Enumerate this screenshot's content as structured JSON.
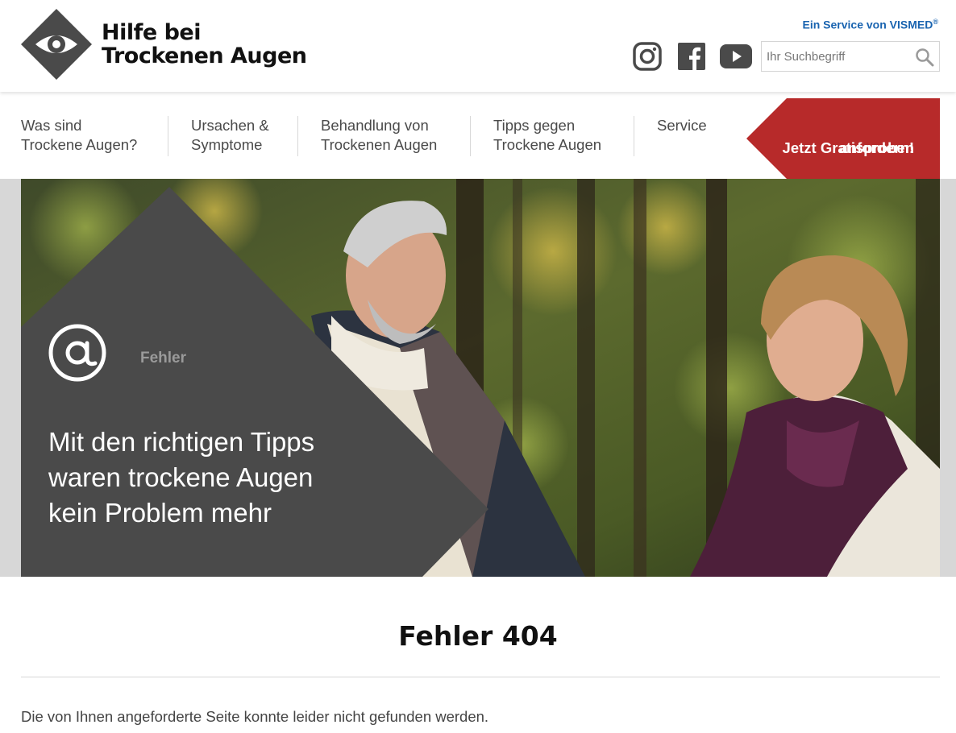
{
  "header": {
    "logo_line1": "Hilfe bei",
    "logo_line2": "Trockenen Augen",
    "service_text": "Ein Service von VISMED",
    "service_mark": "®",
    "social": [
      {
        "name": "instagram-icon"
      },
      {
        "name": "facebook-icon"
      },
      {
        "name": "youtube-icon"
      }
    ],
    "search": {
      "placeholder": "Ihr Suchbegriff",
      "value": ""
    }
  },
  "nav": {
    "items": [
      {
        "line1": "Was sind",
        "line2": "Trockene Augen?"
      },
      {
        "line1": "Ursachen &",
        "line2": "Symptome"
      },
      {
        "line1": "Behandlung von",
        "line2": "Trockenen Augen"
      },
      {
        "line1": "Tipps gegen",
        "line2": "Trockene Augen"
      },
      {
        "line1": "Service",
        "line2": ""
      }
    ],
    "cta_line1": "Jetzt Gratisproben",
    "cta_line2": "anfordern!"
  },
  "hero": {
    "icon": "at-icon",
    "label": "Fehler",
    "text_line1": "Mit den richtigen Tipps",
    "text_line2": "waren trockene Augen",
    "text_line3": "kein Problem mehr"
  },
  "content": {
    "title": "Fehler 404",
    "message": "Die von Ihnen angeforderte Seite konnte leider nicht gefunden werden."
  },
  "colors": {
    "accent_red": "#b72a2a",
    "link_blue": "#1a64b0",
    "overlay_gray": "#4a4a4a",
    "logo_gray": "#4a4a4a"
  }
}
